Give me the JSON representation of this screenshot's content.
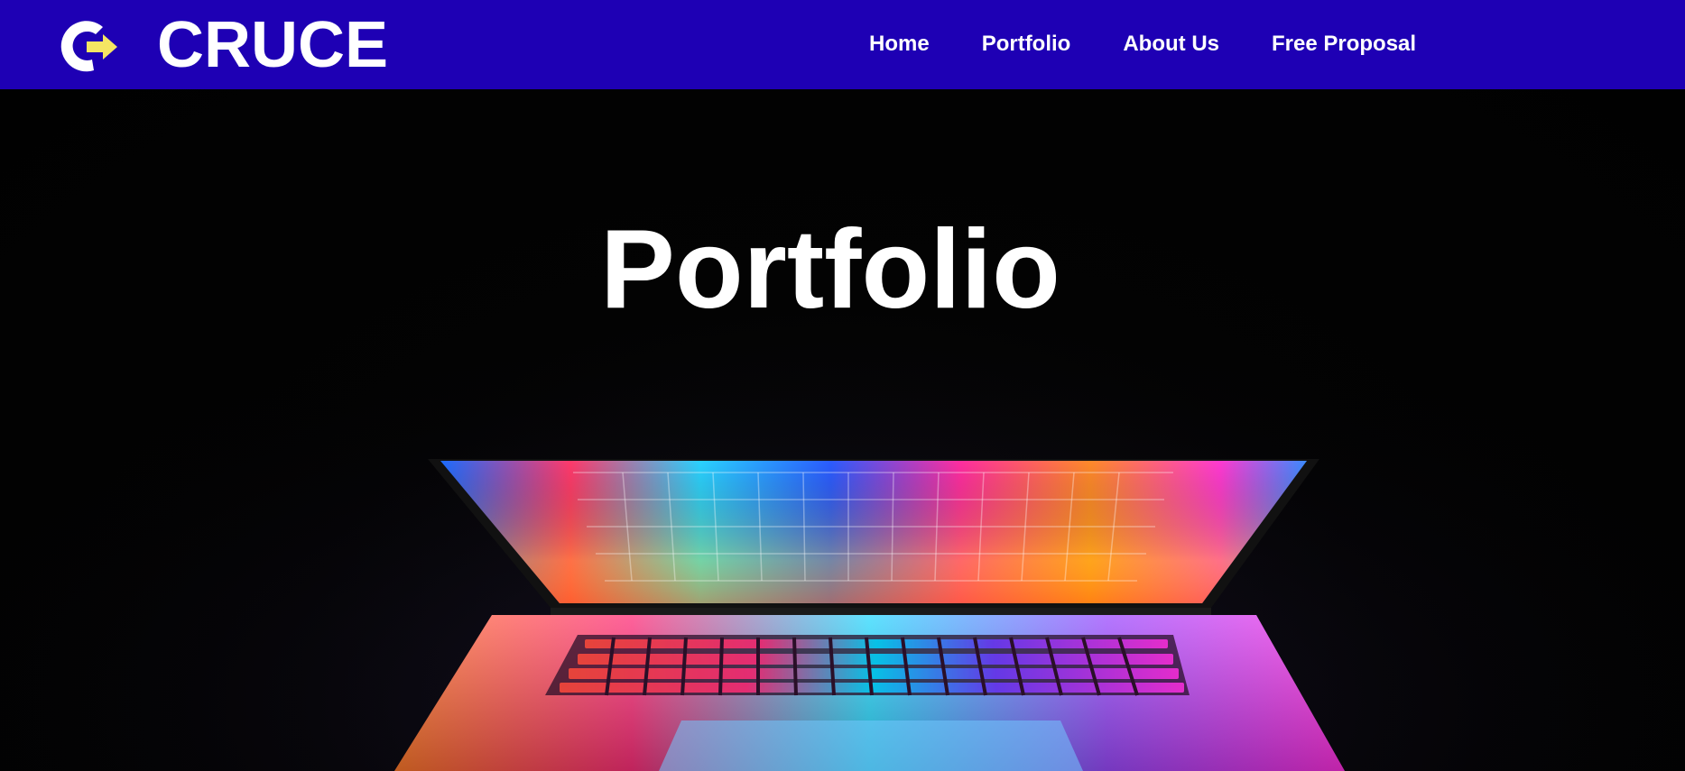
{
  "header": {
    "brand": "CRUCE",
    "logo_icon": "c-arrow-logo-icon",
    "background_color": "#1e00b4",
    "accent_color": "#f5e663"
  },
  "nav": {
    "items": [
      {
        "label": "Home"
      },
      {
        "label": "Portfolio"
      },
      {
        "label": "About Us"
      },
      {
        "label": "Free Proposal"
      }
    ]
  },
  "hero": {
    "title": "Portfolio",
    "image": "laptop-glowing-screen-image"
  }
}
